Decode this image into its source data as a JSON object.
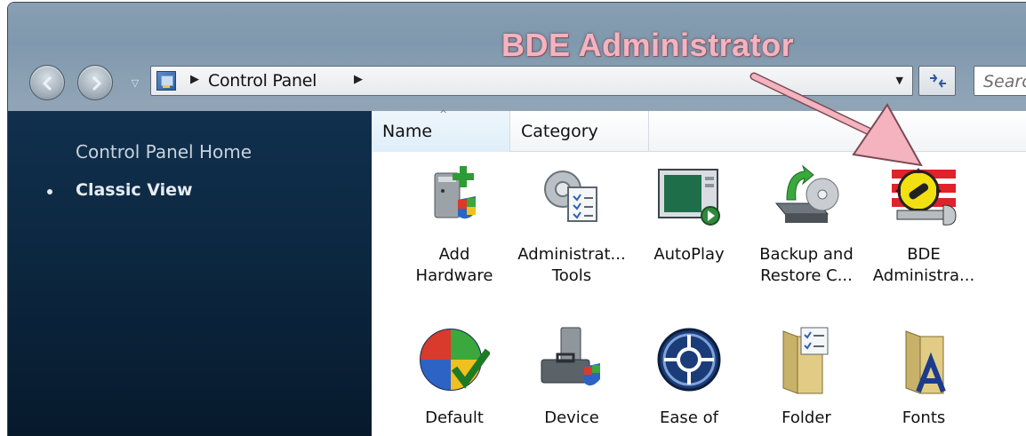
{
  "annotation": {
    "title": "BDE Administrator"
  },
  "address_bar": {
    "crumb": "Control Panel",
    "search_placeholder": "Search"
  },
  "sidebar": {
    "home_link": "Control Panel Home",
    "classic_view": "Classic View"
  },
  "columns": {
    "name": "Name",
    "category": "Category"
  },
  "items_row1": [
    {
      "line1": "Add",
      "line2": "Hardware",
      "icon": "add-hardware-icon"
    },
    {
      "line1": "Administrat...",
      "line2": "Tools",
      "icon": "administrative-tools-icon"
    },
    {
      "line1": "AutoPlay",
      "line2": "",
      "icon": "autoplay-icon"
    },
    {
      "line1": "Backup and",
      "line2": "Restore C...",
      "icon": "backup-restore-icon"
    },
    {
      "line1": "BDE",
      "line2": "Administra...",
      "icon": "bde-administrator-icon"
    }
  ],
  "items_row2": [
    {
      "line1": "Default",
      "icon": "default-programs-icon"
    },
    {
      "line1": "Device",
      "icon": "device-manager-icon"
    },
    {
      "line1": "Ease of",
      "icon": "ease-of-access-icon"
    },
    {
      "line1": "Folder",
      "icon": "folder-options-icon"
    },
    {
      "line1": "Fonts",
      "icon": "fonts-icon"
    }
  ],
  "colors": {
    "sidebar": "#0c2740",
    "annotation": "#f4b3bf",
    "chrome": "#8aa0b3"
  }
}
